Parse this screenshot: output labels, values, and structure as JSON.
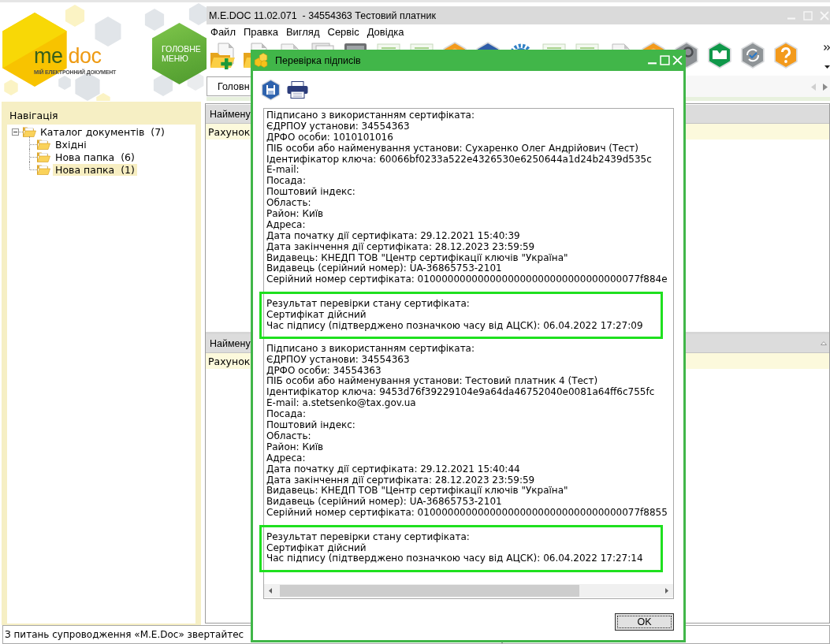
{
  "window": {
    "title": "M.E.DOC 11.02.071  - 34554363 Тестовий платник"
  },
  "logo": {
    "wordmark": [
      "me",
      "doc"
    ],
    "tagline": "МІЙ ЕЛЕКТРОННИЙ ДОКУМЕНТ"
  },
  "main_menu_tile": {
    "label": "ГОЛОВНЕ МЕНЮ"
  },
  "menu": [
    "Файл",
    "Правка",
    "Вигляд",
    "Сервіс",
    "Довідка"
  ],
  "tabs": [
    {
      "label": "Головн",
      "selected": true
    }
  ],
  "navigation": {
    "title": "Навігація",
    "tree": [
      {
        "label": "Каталог документів  (7)",
        "expanded": true,
        "selected": false,
        "children": [
          {
            "label": "Вхідні",
            "selected": false
          },
          {
            "label": "Нова папка  (6)",
            "selected": false
          },
          {
            "label": "Нова папка  (1)",
            "selected": true
          }
        ]
      }
    ]
  },
  "upper_table": {
    "columns": [
      "Наймену"
    ],
    "rows": [
      {
        "cells": [
          "Рахунок"
        ],
        "selected": true
      }
    ]
  },
  "lower_table": {
    "columns": [
      "Наймену"
    ],
    "rows": [
      {
        "cells": [
          "Рахунок"
        ],
        "selected": true
      }
    ]
  },
  "status_bar": {
    "text": "З питань супроводження «M.E.Doc» звертайтес"
  },
  "dialog": {
    "title": "Перевірка підписів",
    "signatures": [
      {
        "details": [
          "Підписано з використанням сертифіката:",
          "ЄДРПОУ установи: 34554363",
          "ДРФО особи: 1010101016",
          "ПІБ особи або найменування установи: Сухаренко Олег Андрійович (Тест)",
          "Ідентифікатор ключа: 60066bf0233a522e4326530e6250644a1d24b2439d535c",
          "E-mail:",
          "Посада:",
          "Поштовий індекс:",
          "Область:",
          "Район: Київ",
          "Адреса:",
          "Дата початку дії сертифіката: 29.12.2021 15:40:39",
          "Дата закінчення дії сертифіката: 28.12.2023 23:59:59",
          "Видавець: КНЕДП ТОВ \"Центр сертифікації ключів \"Україна\"",
          "Видавець (серійний номер): UA-36865753-2101",
          "Серійний номер сертифіката: 0100000000000000000000000000000000077f884e"
        ],
        "result": [
          "Результат перевірки стану сертифіката:",
          "Сертифікат дійсний",
          "Час підпису (підтверджено позначкою часу від АЦСК): 06.04.2022 17:27:09"
        ],
        "highlighted": true
      },
      {
        "details": [
          "Підписано з використанням сертифіката:",
          "ЄДРПОУ установи: 34554363",
          "ДРФО особи: 34554363",
          "ПІБ особи або найменування установи: Тестовий платник 4 (Тест)",
          "Ідентифікатор ключа: 9453d76f39229104e9a64da46752040e0081a64ff6c755fc",
          "E-mail: a.stetsenko@tax.gov.ua",
          "Посада:",
          "Поштовий індекс:",
          "Область:",
          "Район: Київ",
          "Адреса:",
          "Дата початку дії сертифіката: 29.12.2021 15:40:44",
          "Дата закінчення дії сертифіката: 28.12.2023 23:59:59",
          "Видавець: КНЕДП ТОВ \"Центр сертифікації ключів \"Україна\"",
          "Видавець (серійний номер): UA-36865753-2101",
          "Серійний номер сертифіката: 0100000000000000000000000000000000077f8855"
        ],
        "result": [
          "Результат перевірки стану сертифіката:",
          "Сертифікат дійсний",
          "Час підпису (підтверджено позначкою часу від АЦСК): 06.04.2022 17:27:14"
        ],
        "highlighted": true
      }
    ],
    "ok_button": "OK"
  }
}
